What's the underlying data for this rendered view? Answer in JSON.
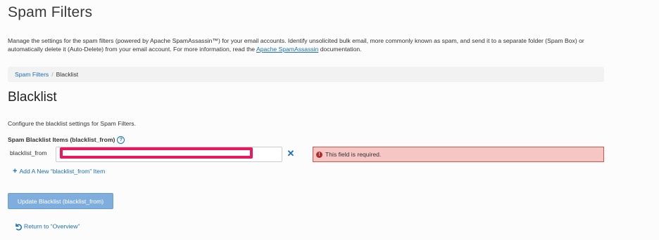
{
  "page": {
    "title": "Spam Filters",
    "description_pre": "Manage the settings for the spam filters (powered by Apache SpamAssassin™) for your email accounts. Identify unsolicited bulk email, more commonly known as spam, and send it to a separate folder (Spam Box) or automatically delete it (Auto-Delete) from your email account. For more information, read the ",
    "description_link": "Apache SpamAssassin",
    "description_post": " documentation."
  },
  "breadcrumb": {
    "parent": "Spam Filters",
    "separator": "/",
    "current": "Blacklist"
  },
  "section": {
    "title": "Blacklist",
    "config_text": "Configure the blacklist settings for Spam Filters.",
    "items_label": "Spam Blacklist Items (blacklist_from)",
    "help_icon": "?"
  },
  "field": {
    "label": "blacklist_from",
    "value": "",
    "remove_icon": "✕"
  },
  "error": {
    "icon": "!",
    "message": "This field is required."
  },
  "actions": {
    "add_plus": "+",
    "add_label": "Add A New “blacklist_from” Item",
    "update_label": "Update Blacklist (blacklist_from)",
    "return_label": "Return to “Overview”"
  },
  "colors": {
    "link": "#1a6fb5",
    "error_bg": "#f5c6c4",
    "error_border": "#d9534f",
    "highlight": "#e8195c",
    "button": "#7faede"
  }
}
